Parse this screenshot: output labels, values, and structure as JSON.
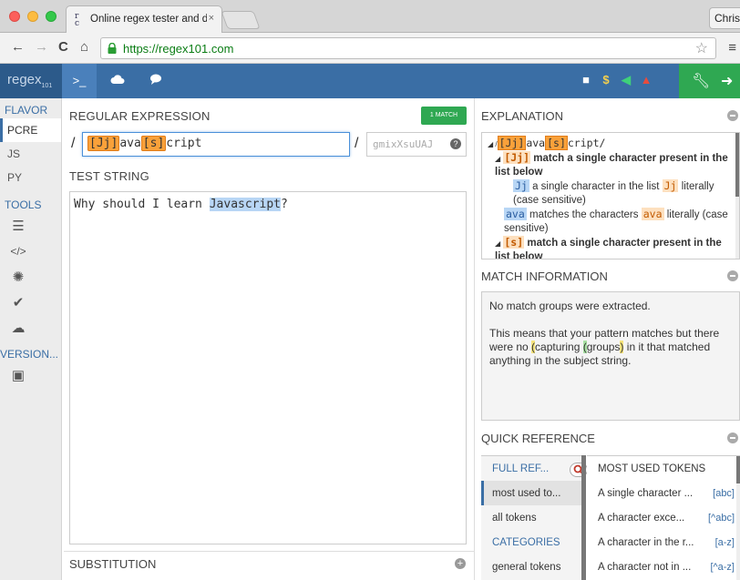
{
  "browser": {
    "tab_title": "Online regex tester and de",
    "tab_close": "×",
    "profile": "Chris",
    "url": "https://regex101.com",
    "back": "←",
    "forward": "→",
    "reload": "C",
    "home": "⌂",
    "star": "☆",
    "menu": "≡"
  },
  "app": {
    "logo": "regex",
    "logo_sub": "101",
    "tab_prompt": ">_",
    "header_icons": [
      "■",
      "$",
      "◀",
      "▲"
    ],
    "header_icon_colors": [
      "#ffffff",
      "#f6d04d",
      "#3fd17a",
      "#e84c3d"
    ]
  },
  "sidebar": {
    "flavor_title": "FLAVOR",
    "flavors": [
      "PCRE",
      "JS",
      "PY"
    ],
    "tools_title": "TOOLS",
    "tools_icons": [
      "format-icon",
      "code-icon",
      "debug-icon",
      "check-icon",
      "upload-icon"
    ],
    "version_title": "VERSION...",
    "version_icon": "save-icon"
  },
  "regex": {
    "heading": "REGULAR EXPRESSION",
    "match_badge": "1 MATCH",
    "slash": "/",
    "tok1": "[Jj]",
    "part1": "ava",
    "tok2": "[s]",
    "part2": "cript",
    "flags_placeholder": "gmixXsuUAJ",
    "flags_help": "?"
  },
  "test": {
    "heading": "TEST STRING",
    "before": "Why should I learn ",
    "match": "Javascript",
    "after": "?"
  },
  "substitution": {
    "heading": "SUBSTITUTION",
    "plus": "+"
  },
  "explanation": {
    "heading": "EXPLANATION",
    "line1_prefix": "◢ /",
    "line1_tok1": "[Jj]",
    "line1_mid": "ava",
    "line1_tok2": "[s]",
    "line1_end": "cript/",
    "line2_prefix": "◢",
    "line2_tok": "[Jj]",
    "line2_text": "match a single character present in the list below",
    "line3_tok": "Jj",
    "line3_text": "a single character in the list",
    "line3_tok2": "Jj",
    "line3_text2": "literally (case sensitive)",
    "line4_tok": "ava",
    "line4_text": "matches the characters",
    "line4_tok2": "ava",
    "line4_text2": "literally (case sensitive)",
    "line5_prefix": "◢",
    "line5_tok": "[s]",
    "line5_text": "match a single character present in the list below"
  },
  "match_info": {
    "heading": "MATCH INFORMATION",
    "line1": "No match groups were extracted.",
    "line2a": "This means that your pattern matches but there were no ",
    "paren_open": "(",
    "capturing": "capturing ",
    "bracket_open": "(",
    "groups": "groups",
    "close_both": ")",
    "line2b": " in it that matched anything in the subject string."
  },
  "quick_ref": {
    "heading": "QUICK REFERENCE",
    "left_title": "FULL REF...",
    "left_items": [
      "most used to...",
      "all tokens"
    ],
    "categories_title": "CATEGORIES",
    "category_items": [
      "general tokens"
    ],
    "right_title": "MOST USED TOKENS",
    "tokens": [
      {
        "desc": "A single character ...",
        "tok": "[abc]"
      },
      {
        "desc": "A character exce...",
        "tok": "[^abc]"
      },
      {
        "desc": "A character in the r...",
        "tok": "[a-z]"
      },
      {
        "desc": "A character not in ...",
        "tok": "[^a-z]"
      }
    ]
  }
}
